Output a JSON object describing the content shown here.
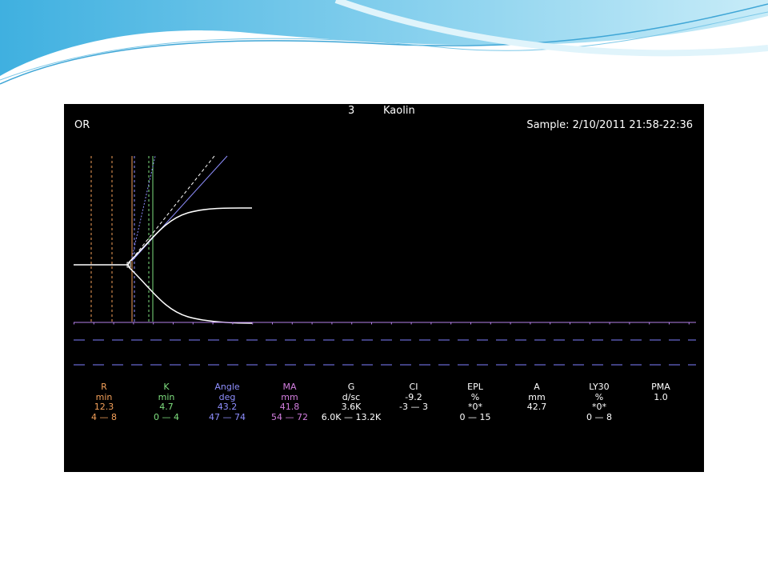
{
  "header": {
    "channel": "3",
    "test": "Kaolin",
    "location": "OR",
    "sample": "Sample: 2/10/2011 21:58-22:36"
  },
  "colors": {
    "R": "#f5a15a",
    "K": "#7fe07f",
    "Angle": "#8f8fff",
    "MA": "#d47fe0",
    "default": "#ffffff",
    "baseline": "#b37fe8",
    "dashes": "#7f7fff"
  },
  "parameters": [
    {
      "name": "R",
      "unit": "min",
      "value": "12.3",
      "range": "4 — 8",
      "color": "#f5a15a"
    },
    {
      "name": "K",
      "unit": "min",
      "value": "4.7",
      "range": "0 — 4",
      "color": "#7fe07f"
    },
    {
      "name": "Angle",
      "unit": "deg",
      "value": "43.2",
      "range": "47 — 74",
      "color": "#8f8fff"
    },
    {
      "name": "MA",
      "unit": "mm",
      "value": "41.8",
      "range": "54 — 72",
      "color": "#d47fe0"
    },
    {
      "name": "G",
      "unit": "d/sc",
      "value": "3.6K",
      "range": "6.0K — 13.2K",
      "color": "#ffffff"
    },
    {
      "name": "CI",
      "unit": "",
      "value": "-9.2",
      "range": "-3 — 3",
      "color": "#ffffff"
    },
    {
      "name": "EPL",
      "unit": "%",
      "value": "*0*",
      "range": "0 — 15",
      "color": "#ffffff"
    },
    {
      "name": "A",
      "unit": "mm",
      "value": "42.7",
      "range": "",
      "color": "#ffffff"
    },
    {
      "name": "LY30",
      "unit": "%",
      "value": "*0*",
      "range": "0 — 8",
      "color": "#ffffff"
    },
    {
      "name": "PMA",
      "unit": "",
      "value": "1.0",
      "range": "",
      "color": "#ffffff"
    }
  ]
}
